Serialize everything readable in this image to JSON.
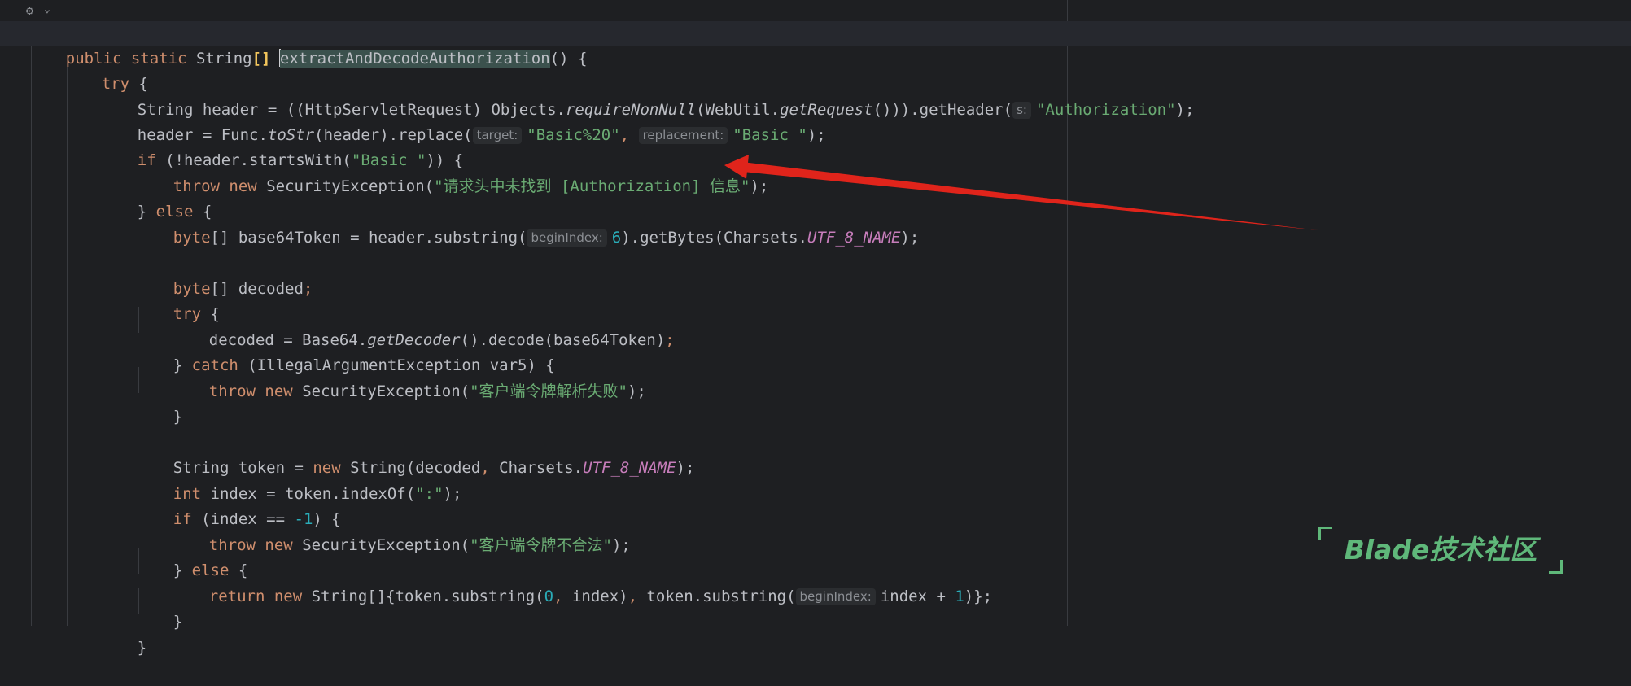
{
  "code": {
    "l1": {
      "mods": "public static",
      "type": "String",
      "brackets": "[]",
      "name": "extractAndDecodeAuthorization",
      "tail": "() {"
    },
    "l2": {
      "kw": "try",
      "tail": " {"
    },
    "l3": {
      "p1": "String header = ((HttpServletRequest) Objects.",
      "m1": "requireNonNull",
      "p2": "(WebUtil.",
      "m2": "getRequest",
      "p3": "())).getHeader(",
      "hint": "s:",
      "str": "\"Authorization\"",
      "end": ");"
    },
    "l4": {
      "p1": "header = Func.",
      "m1": "toStr",
      "p2": "(header).replace(",
      "hint1": "target:",
      "str1": "\"Basic%20\"",
      "comma": ",",
      "hint2": "replacement:",
      "str2": "\"Basic \"",
      "end": ");"
    },
    "l5": {
      "kw": "if",
      "p1": " (!header.startsWith(",
      "str": "\"Basic \"",
      "end": ")) {"
    },
    "l6": {
      "kw1": "throw",
      "kw2": "new",
      "p1": " SecurityException(",
      "str": "\"请求头中未找到 [Authorization] 信息\"",
      "end": ");"
    },
    "l7": {
      "p1": "} ",
      "kw": "else",
      "end": " {"
    },
    "l8": {
      "kw": "byte",
      "p1": "[] base64Token = header.substring(",
      "hint": "beginIndex:",
      "num": "6",
      "p2": ").getBytes(Charsets.",
      "fld": "UTF_8_NAME",
      "end": ");"
    },
    "l10": {
      "kw": "byte",
      "p1": "[] decoded",
      "end": ";"
    },
    "l11": {
      "kw": "try",
      "end": " {"
    },
    "l12": {
      "p1": "decoded = Base64.",
      "m1": "getDecoder",
      "p2": "().decode(base64Token)",
      "end": ";"
    },
    "l13": {
      "p1": "} ",
      "kw": "catch",
      "p2": " (IllegalArgumentException var5) {"
    },
    "l14": {
      "kw1": "throw",
      "kw2": "new",
      "p1": " SecurityException(",
      "str": "\"客户端令牌解析失败\"",
      "end": ");"
    },
    "l15": {
      "p1": "}"
    },
    "l17": {
      "p1": "String token = ",
      "kw": "new",
      "p2": " String(decoded",
      "comma": ",",
      "p3": " Charsets.",
      "fld": "UTF_8_NAME",
      "end": ");"
    },
    "l18": {
      "kw": "int",
      "p1": " index = token.indexOf(",
      "str": "\":\"",
      "end": ");"
    },
    "l19": {
      "kw": "if",
      "p1": " (index == ",
      "num": "-1",
      "end": ") {"
    },
    "l20": {
      "kw1": "throw",
      "kw2": "new",
      "p1": " SecurityException(",
      "str": "\"客户端令牌不合法\"",
      "end": ");"
    },
    "l21": {
      "p1": "} ",
      "kw": "else",
      "end": " {"
    },
    "l22": {
      "kw1": "return",
      "kw2": "new",
      "p1": " String[]{token.substring(",
      "num1": "0",
      "comma": ",",
      "p2": " index)",
      "comma2": ",",
      "p3": " token.substring(",
      "hint": "beginIndex:",
      "p4": "index + ",
      "num2": "1",
      "end": ")};"
    },
    "l23": {
      "p1": "}"
    },
    "l24": {
      "p1": "}"
    }
  },
  "gutter": {
    "icon": "inlay-settings-icon",
    "chevron": "⌄"
  },
  "watermark": {
    "text": "Blade技术社区"
  },
  "colors": {
    "background": "#1e1f22",
    "keyword": "#cf8e6d",
    "string": "#6aab73",
    "number": "#2aacb8",
    "field": "#c77dbb",
    "arrow": "#e0241b"
  }
}
